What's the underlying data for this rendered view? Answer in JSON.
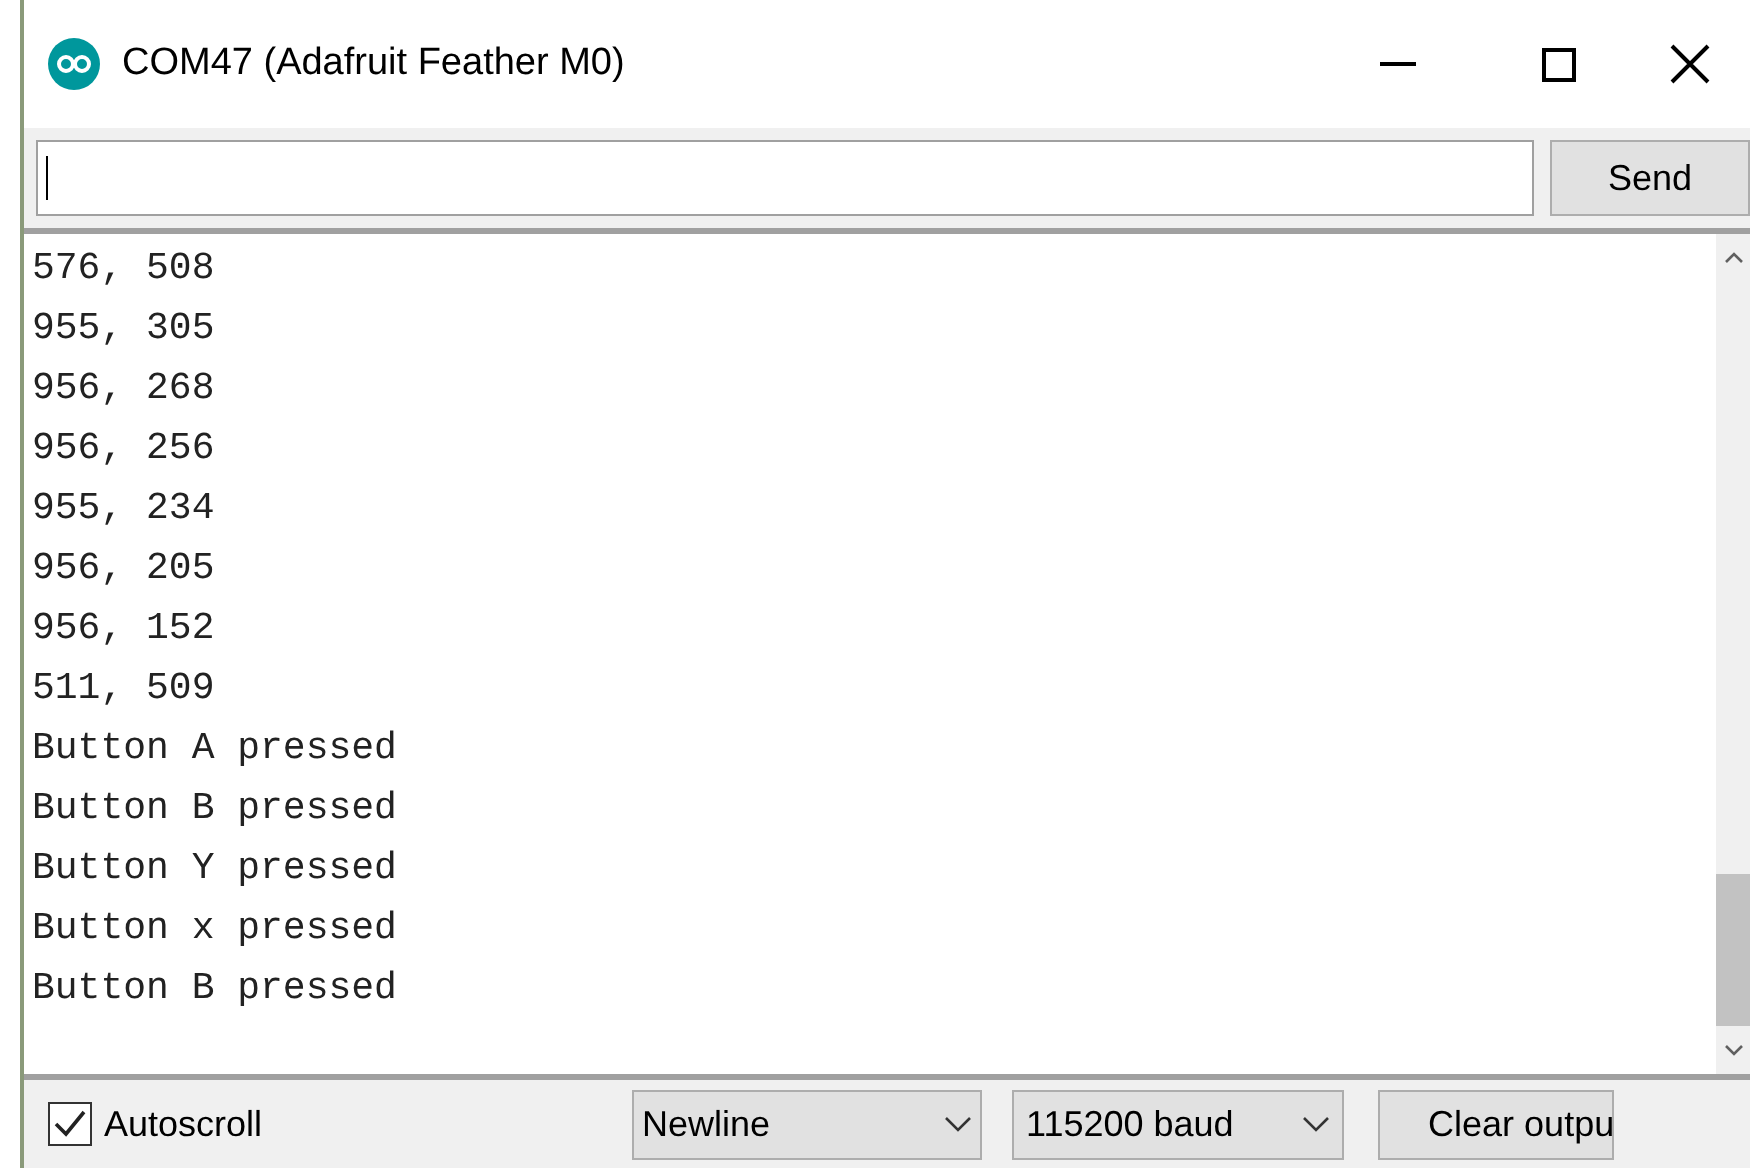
{
  "window": {
    "title": "COM47 (Adafruit Feather M0)"
  },
  "send_button": "Send",
  "output_lines": [
    "576, 508",
    "955, 305",
    "956, 268",
    "956, 256",
    "955, 234",
    "956, 205",
    "956, 152",
    "511, 509",
    "Button A pressed",
    "Button B pressed",
    "Button Y pressed",
    "Button x pressed",
    "Button B pressed"
  ],
  "autoscroll": {
    "label": "Autoscroll",
    "checked": true
  },
  "line_ending": "Newline",
  "baud_rate": "115200 baud",
  "clear_button": "Clear outpu"
}
